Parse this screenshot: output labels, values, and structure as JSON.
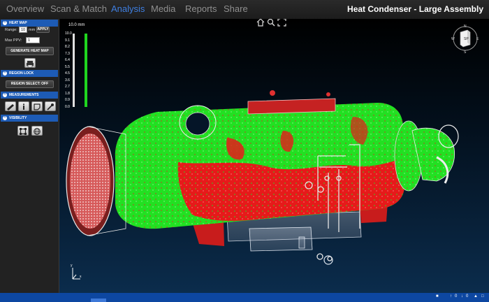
{
  "tabs": [
    "Overview",
    "Scan & Match",
    "Analysis",
    "Media",
    "Reports",
    "Share"
  ],
  "active_tab": "Analysis",
  "app_title": "Heat Condenser - Large Assembly",
  "sidebar": {
    "heat_map": {
      "title": "HEAT MAP",
      "range_label": "Range:",
      "range_value": "10",
      "range_unit": "mm",
      "apply_label": "APPLY",
      "max_ppv_label": "Max PPV:",
      "max_ppv_value": "1",
      "generate_label": "GENERATE HEAT MAP"
    },
    "region_lock": {
      "title": "REGION LOCK",
      "region_select_label": "REGION SELECT: OFF"
    },
    "measurements": {
      "title": "MEASUREMENTS"
    },
    "visibility": {
      "title": "VISIBILITY"
    }
  },
  "legend": {
    "title": "10.0 mm",
    "ticks": [
      "10.0",
      "9.1",
      "8.2",
      "7.3",
      "6.4",
      "5.5",
      "4.5",
      "3.6",
      "2.7",
      "1.8",
      "0.9",
      "0.0"
    ],
    "fill_color": "#1fd51f"
  },
  "orientation_cube": {
    "label": "SP",
    "compass": [
      "N",
      "W",
      "E",
      "S"
    ]
  },
  "axis_labels": {
    "x": "x",
    "y": "y"
  },
  "status": {
    "up_count": "0",
    "down_count": "0"
  },
  "colors": {
    "accent": "#1d5bb5",
    "deviation_high": "#e61a1a",
    "deviation_low": "#1fd51f"
  }
}
